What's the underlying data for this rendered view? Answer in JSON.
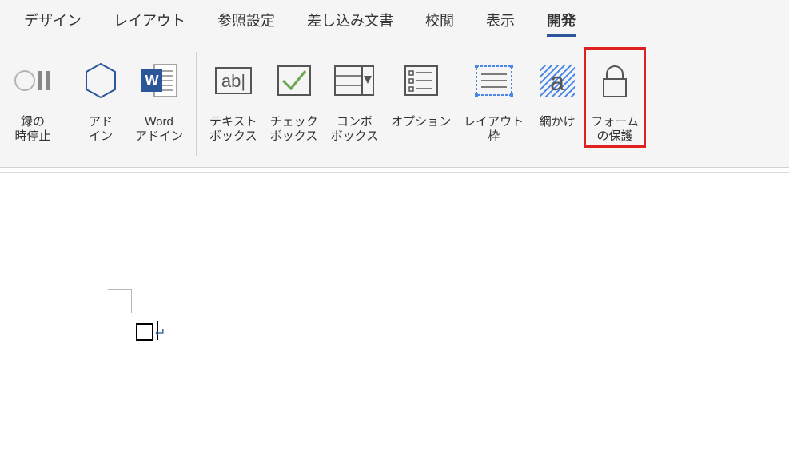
{
  "tabs": [
    {
      "label": "デザイン"
    },
    {
      "label": "レイアウト"
    },
    {
      "label": "参照設定"
    },
    {
      "label": "差し込み文書"
    },
    {
      "label": "校閲"
    },
    {
      "label": "表示"
    },
    {
      "label": "開発"
    }
  ],
  "ribbon": {
    "recordStop": "録の\n時停止",
    "addins": "アド\nイン",
    "wordAddins": "Word\nアドイン",
    "textbox": "テキスト\nボックス",
    "checkbox": "チェック\nボックス",
    "combobox": "コンボ\nボックス",
    "options": "オプション",
    "layoutFrame": "レイアウト\n枠",
    "shading": "網かけ",
    "protectForm": "フォーム\nの保護"
  },
  "doc": {
    "paragraphMark": "↵"
  }
}
